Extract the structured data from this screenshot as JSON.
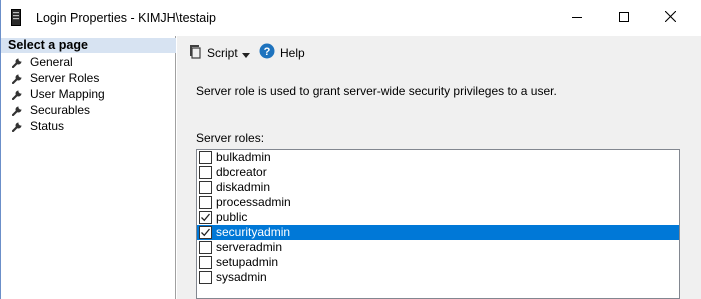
{
  "window": {
    "title": "Login Properties - KIMJH\\testaip"
  },
  "left_panel": {
    "header": "Select a page",
    "pages": [
      {
        "label": "General",
        "icon": "wrench-icon"
      },
      {
        "label": "Server Roles",
        "icon": "wrench-icon"
      },
      {
        "label": "User Mapping",
        "icon": "wrench-icon"
      },
      {
        "label": "Securables",
        "icon": "wrench-icon"
      },
      {
        "label": "Status",
        "icon": "wrench-icon"
      }
    ]
  },
  "toolbar": {
    "script_label": "Script",
    "help_label": "Help"
  },
  "content": {
    "description": "Server role is used to grant server-wide security privileges to a user.",
    "roles_label": "Server roles:",
    "roles": [
      {
        "name": "bulkadmin",
        "checked": false,
        "selected": false
      },
      {
        "name": "dbcreator",
        "checked": false,
        "selected": false
      },
      {
        "name": "diskadmin",
        "checked": false,
        "selected": false
      },
      {
        "name": "processadmin",
        "checked": false,
        "selected": false
      },
      {
        "name": "public",
        "checked": true,
        "selected": false
      },
      {
        "name": "securityadmin",
        "checked": true,
        "selected": true
      },
      {
        "name": "serveradmin",
        "checked": false,
        "selected": false
      },
      {
        "name": "setupadmin",
        "checked": false,
        "selected": false
      },
      {
        "name": "sysadmin",
        "checked": false,
        "selected": false
      }
    ]
  },
  "colors": {
    "selection": "#0078d7",
    "header_bg": "#d7e3f2",
    "panel_bg": "#f0f0f0"
  }
}
